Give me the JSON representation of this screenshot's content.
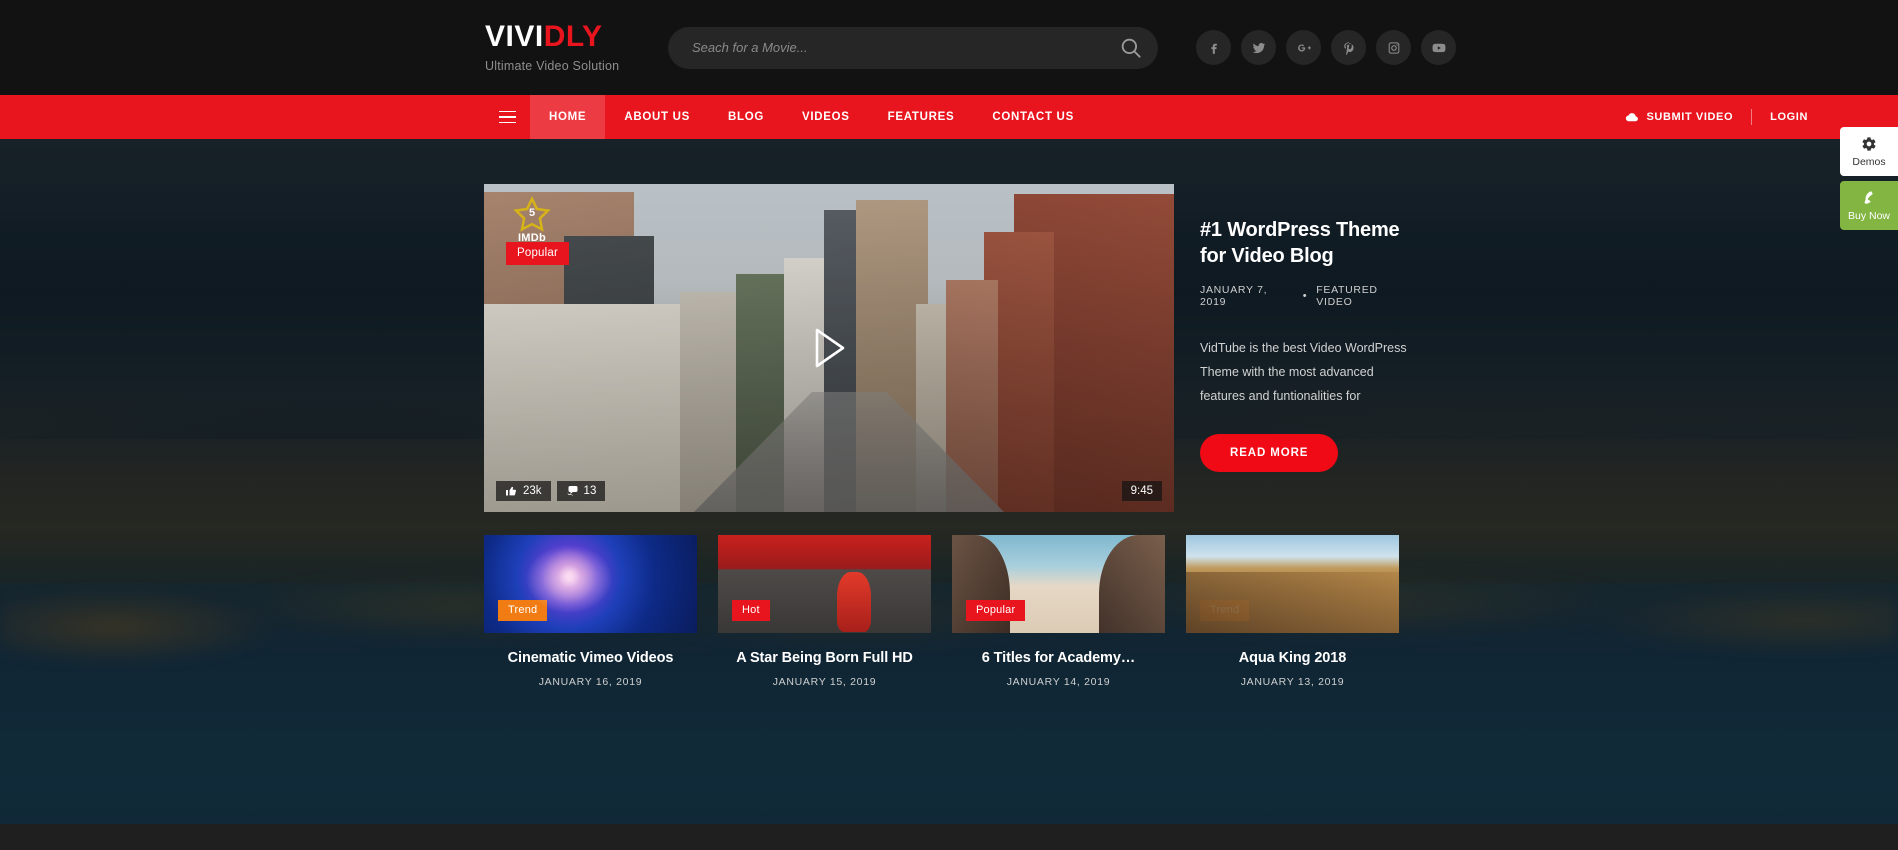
{
  "header": {
    "logo_main": "VIVI",
    "logo_accent": "DLY",
    "tagline": "Ultimate Video Solution",
    "search_placeholder": "Seach for a Movie...",
    "search_value": "",
    "search_icon": "search-icon",
    "socials": [
      {
        "name": "facebook",
        "label": "f"
      },
      {
        "name": "twitter",
        "label": "t"
      },
      {
        "name": "google-plus",
        "label": "G+"
      },
      {
        "name": "pinterest",
        "label": "P"
      },
      {
        "name": "instagram",
        "label": "ig"
      },
      {
        "name": "youtube",
        "label": "yt"
      }
    ]
  },
  "nav": {
    "menu_icon": "hamburger-icon",
    "items": [
      {
        "label": "HOME",
        "active": true
      },
      {
        "label": "ABOUT US",
        "active": false
      },
      {
        "label": "BLOG",
        "active": false
      },
      {
        "label": "VIDEOS",
        "active": false
      },
      {
        "label": "FEATURES",
        "active": false
      },
      {
        "label": "CONTACT US",
        "active": false
      }
    ],
    "submit_video": "SUBMIT VIDEO",
    "submit_icon": "cloud-upload-icon",
    "login": "LOGIN",
    "bar_color": "#e8141e"
  },
  "hero": {
    "featured_video": {
      "imdb_rating": "5",
      "imdb_label": "IMDb",
      "badge": "Popular",
      "badge_color": "#e8141e",
      "likes": "23k",
      "comments": "13",
      "duration": "9:45",
      "play_icon": "play-icon",
      "like_icon": "thumbs-up-icon",
      "comment_icon": "comment-icon"
    },
    "title": "#1 WordPress Theme for Video Blog",
    "date": "JANUARY 7, 2019",
    "separator": "•",
    "category": "FEATURED VIDEO",
    "description": "VidTube is the best Video WordPress Theme with the most advanced features and funtionalities for",
    "read_more": "READ MORE",
    "read_more_color": "#ef0a16"
  },
  "thumbnails": [
    {
      "badge": "Trend",
      "badge_color": "#f07c13",
      "title": "Cinematic Vimeo Videos",
      "date": "JANUARY 16, 2019"
    },
    {
      "badge": "Hot",
      "badge_color": "#e8141e",
      "title": "A Star Being Born Full HD",
      "date": "JANUARY 15, 2019"
    },
    {
      "badge": "Popular",
      "badge_color": "#e8141e",
      "title": "6 Titles for Academy…",
      "date": "JANUARY 14, 2019"
    },
    {
      "badge": "Trend",
      "badge_color": "#f07c13",
      "title": "Aqua King 2018",
      "date": "JANUARY 13, 2019"
    }
  ],
  "side_buttons": [
    {
      "label": "Demos",
      "icon": "gear-icon",
      "color": "#ffffff"
    },
    {
      "label": "Buy Now",
      "icon": "envato-leaf-icon",
      "color": "#82b541"
    }
  ]
}
